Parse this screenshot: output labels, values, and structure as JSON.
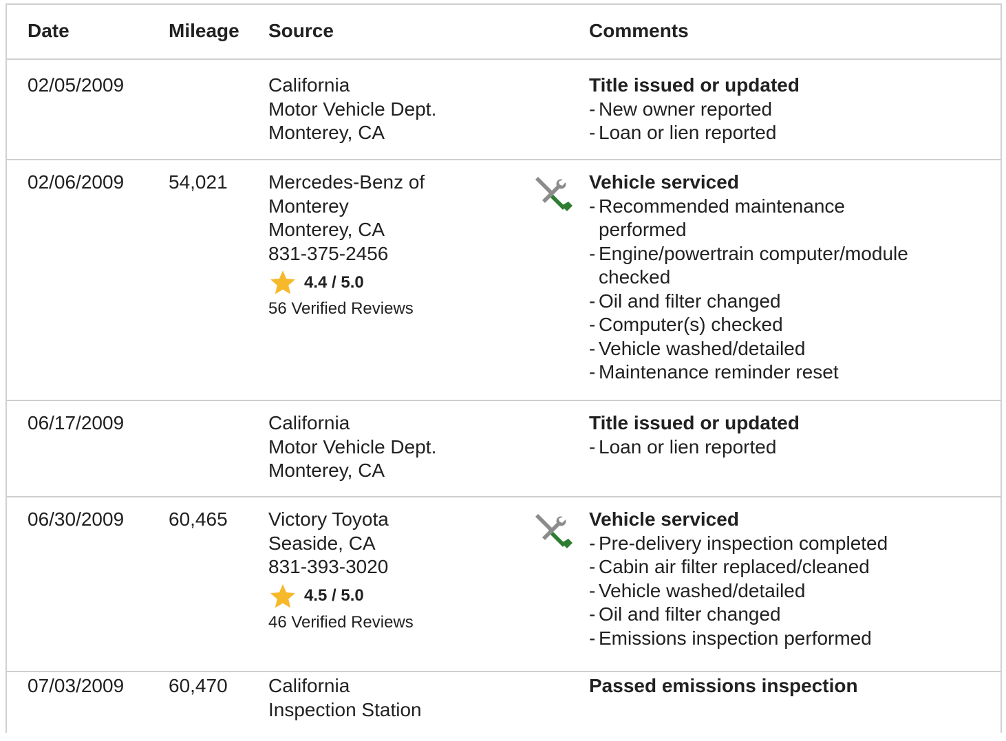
{
  "headers": {
    "date": "Date",
    "mileage": "Mileage",
    "source": "Source",
    "comments": "Comments"
  },
  "rows": [
    {
      "date": "02/05/2009",
      "mileage": "",
      "source": [
        "California",
        "Motor Vehicle Dept.",
        "Monterey, CA"
      ],
      "icon": "",
      "comment_title": "Title issued or updated",
      "bullets": [
        [
          "New owner reported"
        ],
        [
          "Loan or lien reported"
        ]
      ]
    },
    {
      "date": "02/06/2009",
      "mileage": "54,021",
      "source": [
        "Mercedes-Benz of",
        "Monterey",
        "Monterey, CA",
        "831-375-2456"
      ],
      "rating": "4.4 / 5.0",
      "reviews": "56 Verified Reviews",
      "icon": "service-tools-icon",
      "comment_title": "Vehicle serviced",
      "bullets": [
        [
          "Recommended maintenance",
          "performed"
        ],
        [
          "Engine/powertrain computer/module",
          "checked"
        ],
        [
          "Oil and filter changed"
        ],
        [
          "Computer(s) checked"
        ],
        [
          "Vehicle washed/detailed"
        ],
        [
          "Maintenance reminder reset"
        ]
      ]
    },
    {
      "date": "06/17/2009",
      "mileage": "",
      "source": [
        "California",
        "Motor Vehicle Dept.",
        "Monterey, CA"
      ],
      "icon": "",
      "comment_title": "Title issued or updated",
      "bullets": [
        [
          "Loan or lien reported"
        ]
      ]
    },
    {
      "date": "06/30/2009",
      "mileage": "60,465",
      "source": [
        "Victory Toyota",
        "Seaside, CA",
        "831-393-3020"
      ],
      "rating": "4.5 / 5.0",
      "reviews": "46 Verified Reviews",
      "icon": "service-tools-icon",
      "comment_title": "Vehicle serviced",
      "bullets": [
        [
          "Pre-delivery inspection completed"
        ],
        [
          "Cabin air filter replaced/cleaned"
        ],
        [
          "Vehicle washed/detailed"
        ],
        [
          "Oil and filter changed"
        ],
        [
          "Emissions inspection performed"
        ]
      ]
    },
    {
      "date": "07/03/2009",
      "mileage": "60,470",
      "source": [
        "California",
        "Inspection Station"
      ],
      "icon": "",
      "comment_title": "Passed emissions inspection",
      "bullets": []
    }
  ],
  "colors": {
    "text": "#212121",
    "border": "#cfcfcf",
    "star": "#f6b92b",
    "wrench_gray": "#8c8c8c",
    "screwdriver_green": "#2e7d32"
  }
}
